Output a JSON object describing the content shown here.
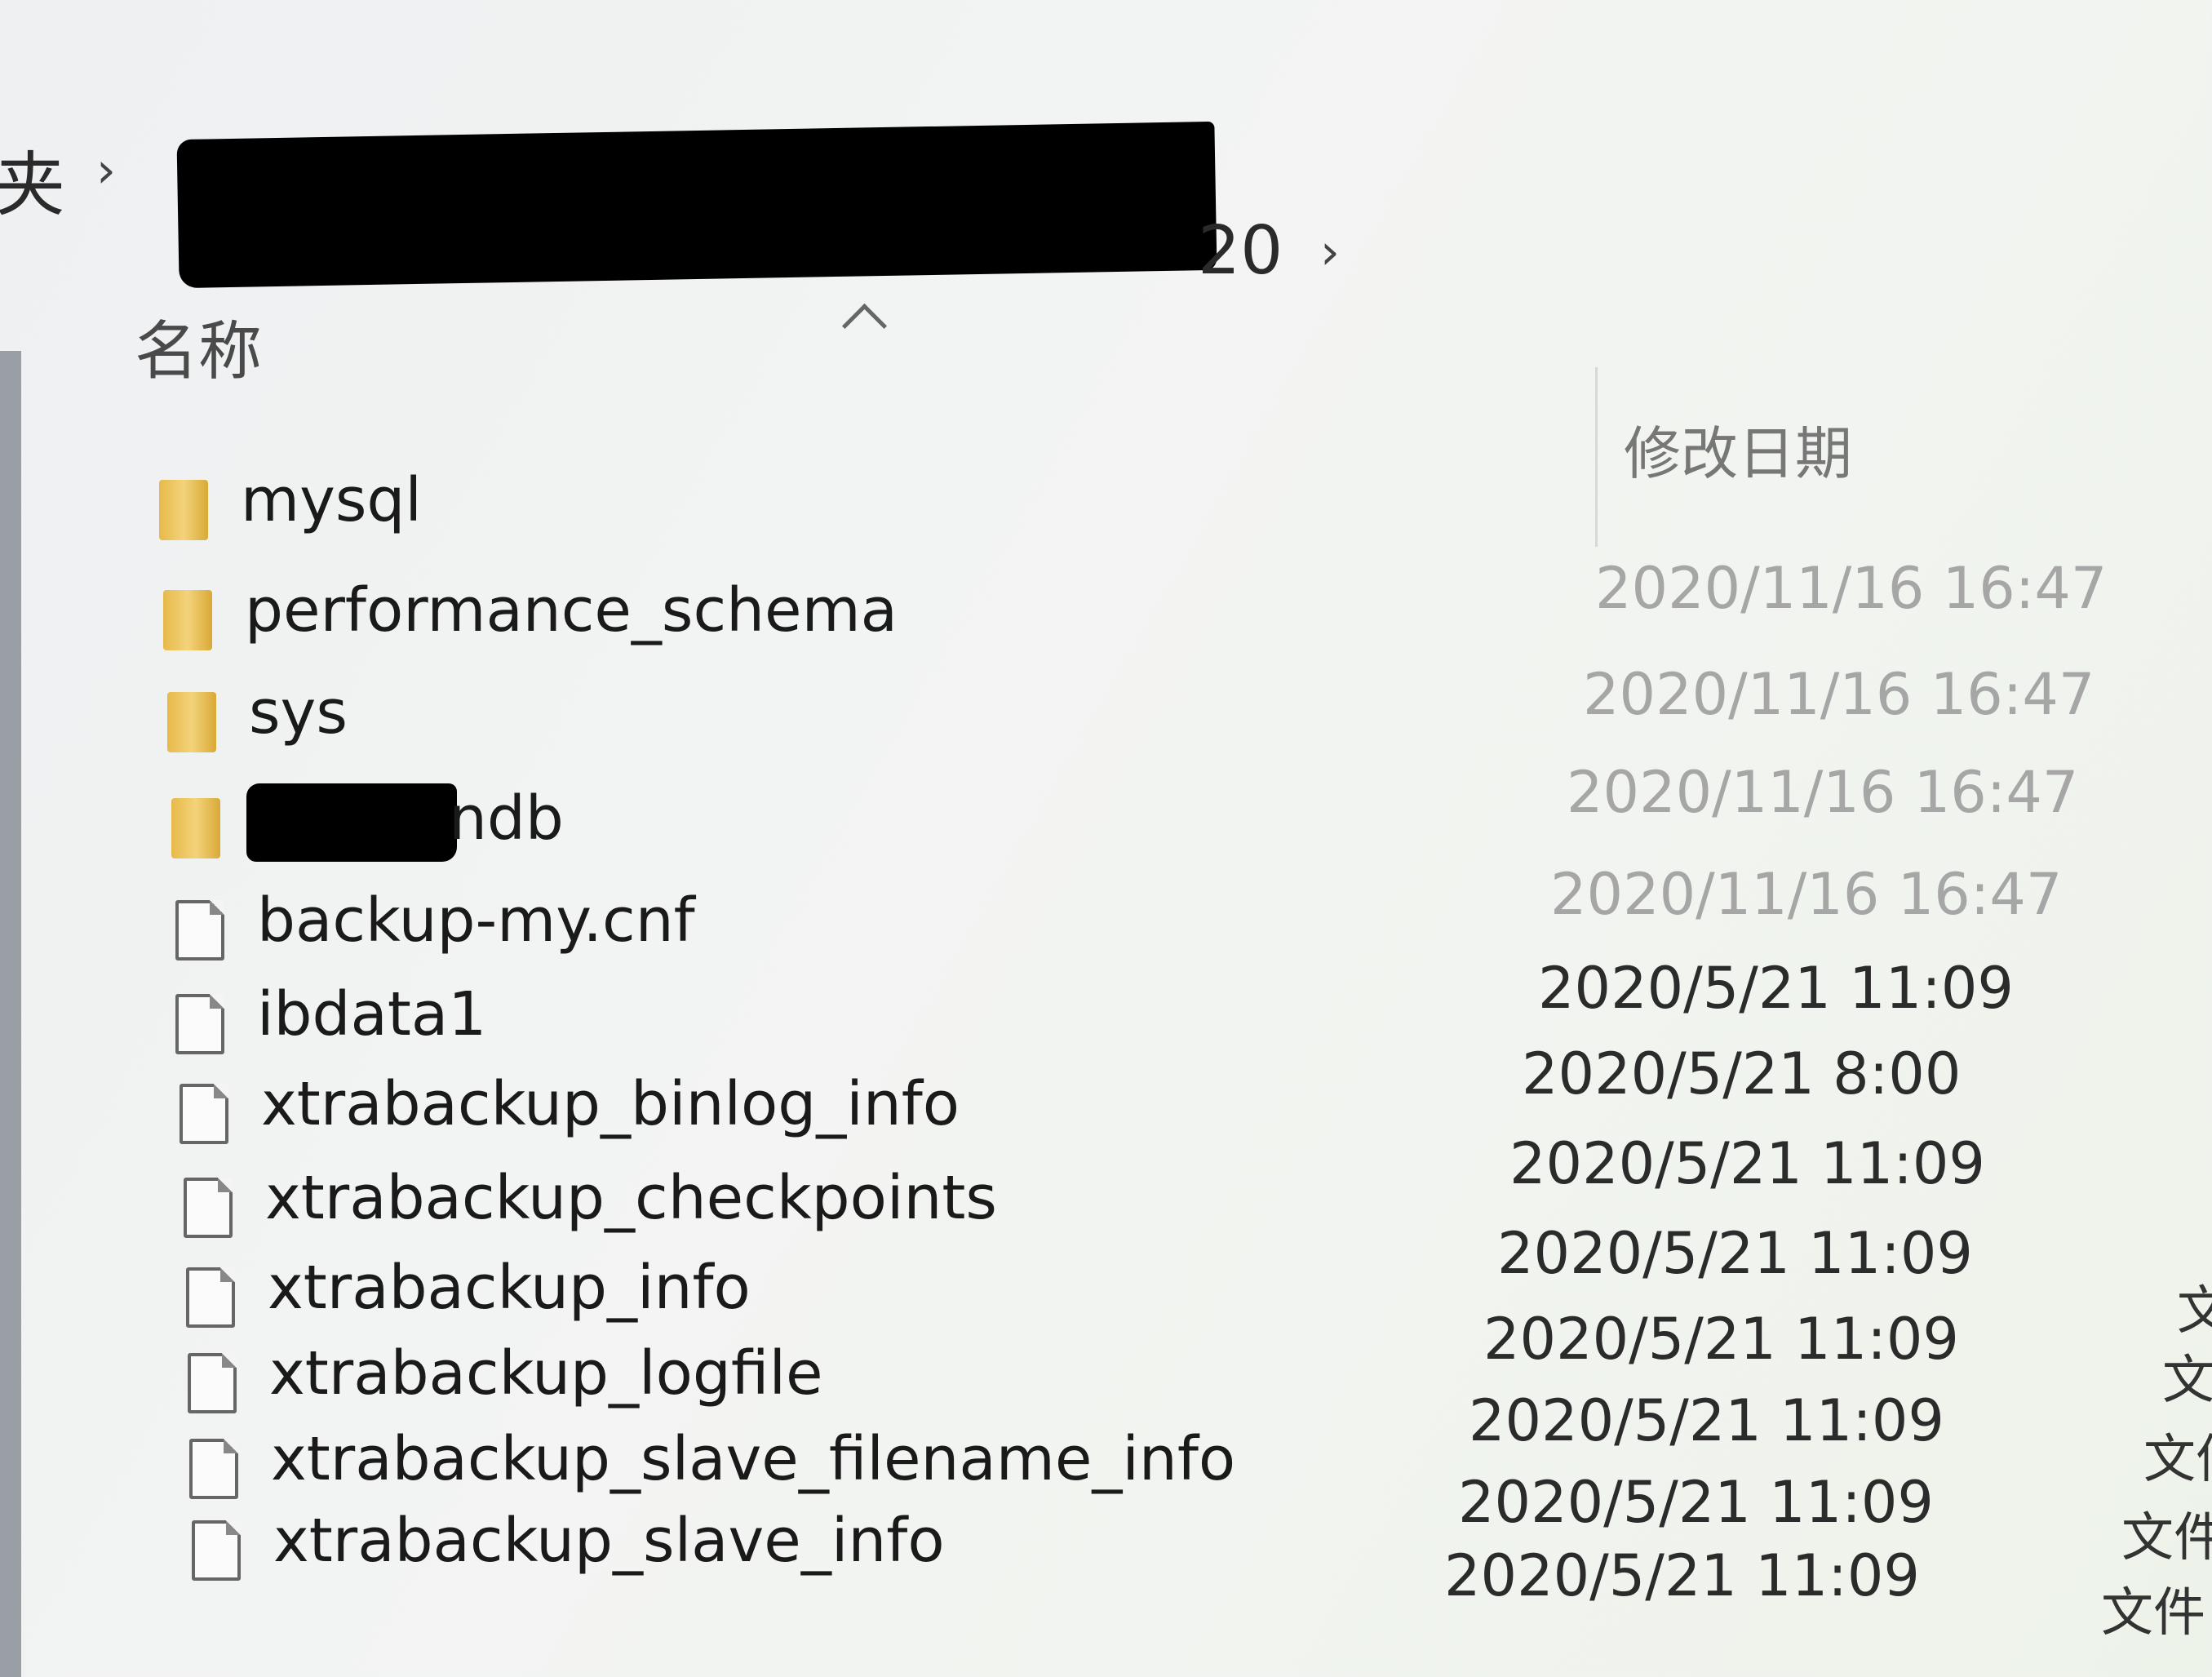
{
  "breadcrumb": {
    "prev_segment": "夹",
    "path_tail": "20"
  },
  "columns": {
    "name": "名称",
    "date_modified": "修改日期"
  },
  "icons": {
    "separator": "chevron-right-icon",
    "sort": "sort-ascending-icon",
    "folder": "folder-icon",
    "file": "file-icon"
  },
  "rows": [
    {
      "name": "mysql",
      "date": "2020/11/16 16:47",
      "kind": "folder",
      "type": ""
    },
    {
      "name": "performance_schema",
      "date": "2020/11/16 16:47",
      "kind": "folder",
      "type": ""
    },
    {
      "name": "sys",
      "date": "2020/11/16 16:47",
      "kind": "folder",
      "type": ""
    },
    {
      "name": "ndb",
      "date": "2020/11/16 16:47",
      "kind": "folder",
      "type": "",
      "redacted_prefix": true
    },
    {
      "name": "backup-my.cnf",
      "date": "2020/5/21 11:09",
      "kind": "file",
      "type": ""
    },
    {
      "name": "ibdata1",
      "date": "2020/5/21 8:00",
      "kind": "file",
      "type": ""
    },
    {
      "name": "xtrabackup_binlog_info",
      "date": "2020/5/21 11:09",
      "kind": "file",
      "type": ""
    },
    {
      "name": "xtrabackup_checkpoints",
      "date": "2020/5/21 11:09",
      "kind": "file",
      "type": ""
    },
    {
      "name": "xtrabackup_info",
      "date": "2020/5/21 11:09",
      "kind": "file",
      "type": "文"
    },
    {
      "name": "xtrabackup_logfile",
      "date": "2020/5/21 11:09",
      "kind": "file",
      "type": "文"
    },
    {
      "name": "xtrabackup_slave_filename_info",
      "date": "2020/5/21 11:09",
      "kind": "file",
      "type": "文件"
    },
    {
      "name": "xtrabackup_slave_info",
      "date": "2020/5/21 11:09",
      "kind": "file",
      "type": "文件"
    },
    {
      "name": "",
      "date": "",
      "kind": "none",
      "type": "文件"
    }
  ]
}
